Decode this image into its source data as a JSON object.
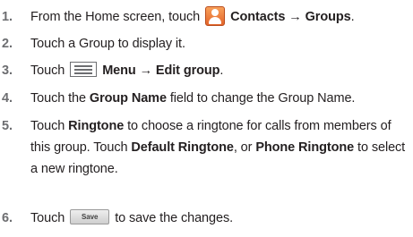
{
  "steps": [
    {
      "number": "1.",
      "pre": "From the Home screen, touch",
      "icon": "contacts-icon",
      "bold": "Contacts → Groups",
      "post": "."
    },
    {
      "number": "2.",
      "text": "Touch a Group to display it."
    },
    {
      "number": "3.",
      "pre": "Touch",
      "icon": "menu-icon",
      "bold": "Menu → Edit group",
      "post": "."
    },
    {
      "number": "4.",
      "pre": "Touch the",
      "bold": "Group Name",
      "post": "field to change the Group Name."
    },
    {
      "number": "5.",
      "pre": "Touch",
      "bold1": "Ringtone",
      "mid1": "to choose a ringtone for calls from members of this group. Touch",
      "bold2": "Default Ringtone",
      "mid2": ", or",
      "bold3": "Phone Ringtone",
      "post": "to select a new ringtone."
    },
    {
      "number": "6.",
      "pre": "Touch",
      "button_label": "Save",
      "post": "to save the changes."
    }
  ]
}
